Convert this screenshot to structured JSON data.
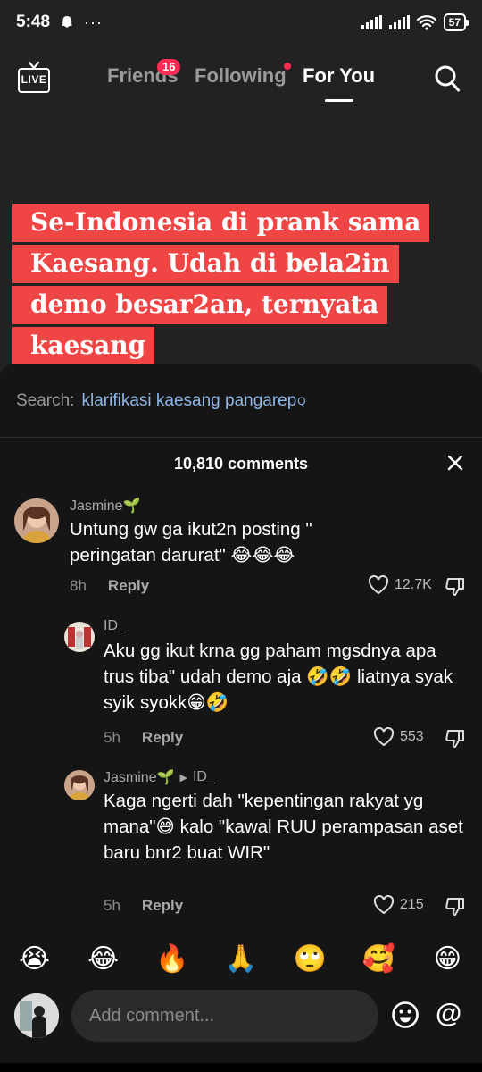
{
  "status_bar": {
    "time": "5:48",
    "battery": "57"
  },
  "nav": {
    "friends": "Friends",
    "friends_badge": "16",
    "following": "Following",
    "for_you": "For You",
    "live": "LIVE"
  },
  "caption": "Se-Indonesia di prank sama Kaesang. Udah di bela2in demo besar2an, ternyata kaesang",
  "search": {
    "label": "Search:",
    "term": "klarifikasi kaesang pangarep"
  },
  "comments_header": "10,810 comments",
  "comments": [
    {
      "user": "Jasmine🌱",
      "text": "Untung gw ga ikut2n posting \" peringatan darurat\" 😂😂😂",
      "time": "8h",
      "reply": "Reply",
      "likes": "12.7K"
    },
    {
      "user": "ID_",
      "text": "Aku gg ikut krna gg paham mgsdnya apa trus tiba\" udah demo aja 🤣🤣 liatnya syak syik syokk😁🤣",
      "time": "5h",
      "reply": "Reply",
      "likes": "553"
    },
    {
      "user": "Jasmine🌱",
      "reply_to": "ID_",
      "text": "Kaga ngerti dah \"kepentingan rakyat yg mana\"😅 kalo \"kawal RUU perampasan aset baru bnr2 buat WIR\"",
      "time": "5h",
      "reply": "Reply",
      "likes": "215"
    }
  ],
  "emoji_bar": [
    "😭",
    "😂",
    "🔥",
    "🙏",
    "🙄",
    "🥰",
    "😁"
  ],
  "composer": {
    "placeholder": "Add comment..."
  },
  "colors": {
    "accent": "#fe2c55",
    "caption_bg": "#f04545",
    "panel_bg": "#151515",
    "link": "#8fb6e6"
  }
}
